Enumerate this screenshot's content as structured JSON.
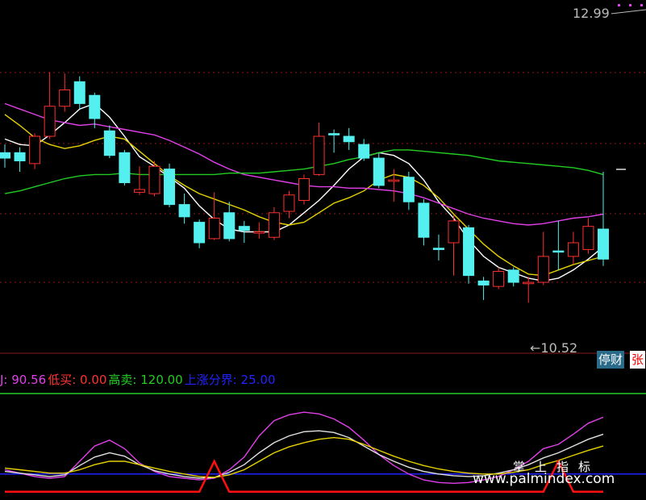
{
  "chart_data": {
    "type": "candlestick",
    "price_axis": {
      "high_label": "12.99",
      "low_label": "10.52"
    },
    "candles": [
      {
        "o": 11.92,
        "c": 11.96,
        "h": 12.02,
        "l": 11.85,
        "dir": "down"
      },
      {
        "o": 11.96,
        "c": 11.9,
        "h": 12.0,
        "l": 11.82,
        "dir": "down"
      },
      {
        "o": 11.88,
        "c": 12.08,
        "h": 12.1,
        "l": 11.84,
        "dir": "up"
      },
      {
        "o": 12.08,
        "c": 12.3,
        "h": 12.55,
        "l": 12.06,
        "dir": "up"
      },
      {
        "o": 12.3,
        "c": 12.42,
        "h": 12.54,
        "l": 12.26,
        "dir": "up"
      },
      {
        "o": 12.32,
        "c": 12.48,
        "h": 12.52,
        "l": 12.28,
        "dir": "down"
      },
      {
        "o": 12.38,
        "c": 12.21,
        "h": 12.4,
        "l": 12.14,
        "dir": "down"
      },
      {
        "o": 12.12,
        "c": 11.94,
        "h": 12.16,
        "l": 11.92,
        "dir": "down"
      },
      {
        "o": 11.96,
        "c": 11.74,
        "h": 11.98,
        "l": 11.72,
        "dir": "down"
      },
      {
        "o": 11.67,
        "c": 11.69,
        "h": 11.86,
        "l": 11.65,
        "dir": "up"
      },
      {
        "o": 11.66,
        "c": 11.86,
        "h": 11.9,
        "l": 11.64,
        "dir": "up"
      },
      {
        "o": 11.84,
        "c": 11.58,
        "h": 11.88,
        "l": 11.56,
        "dir": "down"
      },
      {
        "o": 11.58,
        "c": 11.49,
        "h": 11.66,
        "l": 11.44,
        "dir": "down"
      },
      {
        "o": 11.45,
        "c": 11.3,
        "h": 11.47,
        "l": 11.26,
        "dir": "down"
      },
      {
        "o": 11.33,
        "c": 11.48,
        "h": 11.67,
        "l": 11.32,
        "dir": "up"
      },
      {
        "o": 11.52,
        "c": 11.33,
        "h": 11.6,
        "l": 11.31,
        "dir": "down"
      },
      {
        "o": 11.39,
        "c": 11.42,
        "h": 11.46,
        "l": 11.3,
        "dir": "down"
      },
      {
        "o": 11.38,
        "c": 11.37,
        "h": 11.45,
        "l": 11.33,
        "dir": "up"
      },
      {
        "o": 11.34,
        "c": 11.52,
        "h": 11.56,
        "l": 11.32,
        "dir": "up"
      },
      {
        "o": 11.53,
        "c": 11.65,
        "h": 11.68,
        "l": 11.48,
        "dir": "up"
      },
      {
        "o": 11.61,
        "c": 11.77,
        "h": 11.8,
        "l": 11.58,
        "dir": "up"
      },
      {
        "o": 11.8,
        "c": 12.08,
        "h": 12.18,
        "l": 11.79,
        "dir": "up"
      },
      {
        "o": 12.09,
        "c": 12.1,
        "h": 12.13,
        "l": 11.96,
        "dir": "down"
      },
      {
        "o": 12.08,
        "c": 12.04,
        "h": 12.14,
        "l": 11.98,
        "dir": "down"
      },
      {
        "o": 12.02,
        "c": 11.92,
        "h": 12.06,
        "l": 11.9,
        "dir": "down"
      },
      {
        "o": 11.92,
        "c": 11.72,
        "h": 11.96,
        "l": 11.7,
        "dir": "down"
      },
      {
        "o": 11.75,
        "c": 11.76,
        "h": 11.84,
        "l": 11.6,
        "dir": "up"
      },
      {
        "o": 11.78,
        "c": 11.6,
        "h": 11.82,
        "l": 11.54,
        "dir": "down"
      },
      {
        "o": 11.59,
        "c": 11.34,
        "h": 11.62,
        "l": 11.28,
        "dir": "down"
      },
      {
        "o": 11.26,
        "c": 11.25,
        "h": 11.36,
        "l": 11.17,
        "dir": "down"
      },
      {
        "o": 11.3,
        "c": 11.46,
        "h": 11.5,
        "l": 11.06,
        "dir": "up"
      },
      {
        "o": 11.41,
        "c": 11.06,
        "h": 11.43,
        "l": 11.0,
        "dir": "down"
      },
      {
        "o": 11.02,
        "c": 10.99,
        "h": 11.05,
        "l": 10.88,
        "dir": "down"
      },
      {
        "o": 10.98,
        "c": 11.09,
        "h": 11.12,
        "l": 10.96,
        "dir": "up"
      },
      {
        "o": 11.1,
        "c": 11.01,
        "h": 11.12,
        "l": 10.98,
        "dir": "down"
      },
      {
        "o": 11.01,
        "c": 11.0,
        "h": 11.05,
        "l": 10.86,
        "dir": "up"
      },
      {
        "o": 11.01,
        "c": 11.2,
        "h": 11.38,
        "l": 10.99,
        "dir": "up"
      },
      {
        "o": 11.24,
        "c": 11.24,
        "h": 11.46,
        "l": 11.1,
        "dir": "down"
      },
      {
        "o": 11.2,
        "c": 11.3,
        "h": 11.38,
        "l": 11.14,
        "dir": "up"
      },
      {
        "o": 11.25,
        "c": 11.42,
        "h": 11.48,
        "l": 11.22,
        "dir": "up"
      },
      {
        "o": 11.4,
        "c": 11.18,
        "h": 11.82,
        "l": 11.13,
        "dir": "down"
      }
    ],
    "ma_lines": [
      {
        "color": "#ffffff",
        "values": [
          12.06,
          12.02,
          12.01,
          12.09,
          12.18,
          12.28,
          12.32,
          12.22,
          12.08,
          11.93,
          11.86,
          11.78,
          11.7,
          11.57,
          11.47,
          11.4,
          11.38,
          11.38,
          11.38,
          11.43,
          11.52,
          11.61,
          11.72,
          11.84,
          11.93,
          11.96,
          11.94,
          11.88,
          11.76,
          11.6,
          11.48,
          11.32,
          11.2,
          11.12,
          11.08,
          11.04,
          11.02,
          11.04,
          11.1,
          11.18,
          11.27
        ]
      },
      {
        "color": "#e6d200",
        "values": [
          12.24,
          12.16,
          12.07,
          12.02,
          11.99,
          12.01,
          12.05,
          12.08,
          12.06,
          11.97,
          11.88,
          11.79,
          11.72,
          11.66,
          11.62,
          11.58,
          11.54,
          11.49,
          11.45,
          11.43,
          11.45,
          11.52,
          11.59,
          11.63,
          11.68,
          11.76,
          11.8,
          11.78,
          11.72,
          11.63,
          11.51,
          11.4,
          11.29,
          11.2,
          11.13,
          11.07,
          11.06,
          11.1,
          11.14,
          11.17,
          11.2
        ]
      },
      {
        "color": "#e040e8",
        "values": [
          12.32,
          12.28,
          12.24,
          12.2,
          12.18,
          12.16,
          12.17,
          12.15,
          12.13,
          12.11,
          12.09,
          12.05,
          12.0,
          11.95,
          11.89,
          11.84,
          11.8,
          11.78,
          11.76,
          11.74,
          11.72,
          11.71,
          11.71,
          11.7,
          11.7,
          11.69,
          11.68,
          11.66,
          11.63,
          11.59,
          11.55,
          11.51,
          11.48,
          11.46,
          11.44,
          11.43,
          11.44,
          11.46,
          11.48,
          11.49,
          11.51
        ]
      },
      {
        "color": "#22cc22",
        "values": [
          11.66,
          11.68,
          11.71,
          11.74,
          11.77,
          11.79,
          11.8,
          11.8,
          11.81,
          11.8,
          11.8,
          11.8,
          11.8,
          11.8,
          11.8,
          11.81,
          11.81,
          11.81,
          11.82,
          11.83,
          11.84,
          11.86,
          11.88,
          11.91,
          11.93,
          11.96,
          11.98,
          11.98,
          11.97,
          11.96,
          11.95,
          11.94,
          11.92,
          11.9,
          11.89,
          11.88,
          11.87,
          11.86,
          11.85,
          11.83,
          11.8
        ]
      }
    ],
    "indicator": {
      "labels": [
        {
          "text": "J: 90.56",
          "color": "#e040e8"
        },
        {
          "text": "低买: 0.00",
          "color": "#ff3333"
        },
        {
          "text": "高卖: 120.00",
          "color": "#22cc22"
        },
        {
          "text": "上涨分界: 25.00",
          "color": "#2222ff"
        }
      ],
      "range": [
        0,
        120
      ],
      "sell_level": 120,
      "boundary_level": 25,
      "buy_level": 0,
      "series": [
        {
          "name": "J",
          "color": "#e040e8",
          "values": [
            30,
            26,
            22,
            20,
            22,
            40,
            58,
            65,
            55,
            38,
            28,
            22,
            20,
            18,
            20,
            30,
            45,
            70,
            88,
            95,
            98,
            96,
            90,
            80,
            65,
            48,
            35,
            25,
            18,
            15,
            14,
            15,
            18,
            22,
            30,
            40,
            55,
            60,
            72,
            85,
            92
          ]
        },
        {
          "name": "K",
          "color": "#e0e0e0",
          "values": [
            28,
            26,
            24,
            22,
            24,
            35,
            45,
            50,
            46,
            36,
            29,
            25,
            22,
            20,
            21,
            27,
            36,
            50,
            62,
            70,
            75,
            76,
            74,
            68,
            58,
            48,
            40,
            33,
            28,
            25,
            23,
            22,
            23,
            26,
            30,
            36,
            44,
            50,
            58,
            66,
            72
          ]
        },
        {
          "name": "D",
          "color": "#e6d200",
          "values": [
            32,
            30,
            28,
            26,
            26,
            30,
            36,
            40,
            40,
            36,
            32,
            28,
            25,
            22,
            21,
            24,
            30,
            40,
            50,
            57,
            62,
            66,
            68,
            66,
            60,
            53,
            46,
            40,
            35,
            31,
            28,
            26,
            25,
            25,
            27,
            30,
            36,
            41,
            47,
            53,
            58
          ]
        },
        {
          "name": "B",
          "color": "#ff1010",
          "values": [
            4,
            4,
            4,
            4,
            4,
            4,
            4,
            4,
            4,
            4,
            4,
            4,
            4,
            4,
            40,
            4,
            4,
            4,
            4,
            4,
            4,
            4,
            4,
            4,
            4,
            4,
            4,
            4,
            4,
            4,
            4,
            4,
            4,
            4,
            4,
            4,
            4,
            40,
            4,
            4,
            4
          ]
        }
      ]
    }
  },
  "badges": {
    "halt": "停财",
    "rise": "张"
  },
  "watermark": {
    "cn": "掌上指标",
    "url": "www.palmindex.com"
  }
}
